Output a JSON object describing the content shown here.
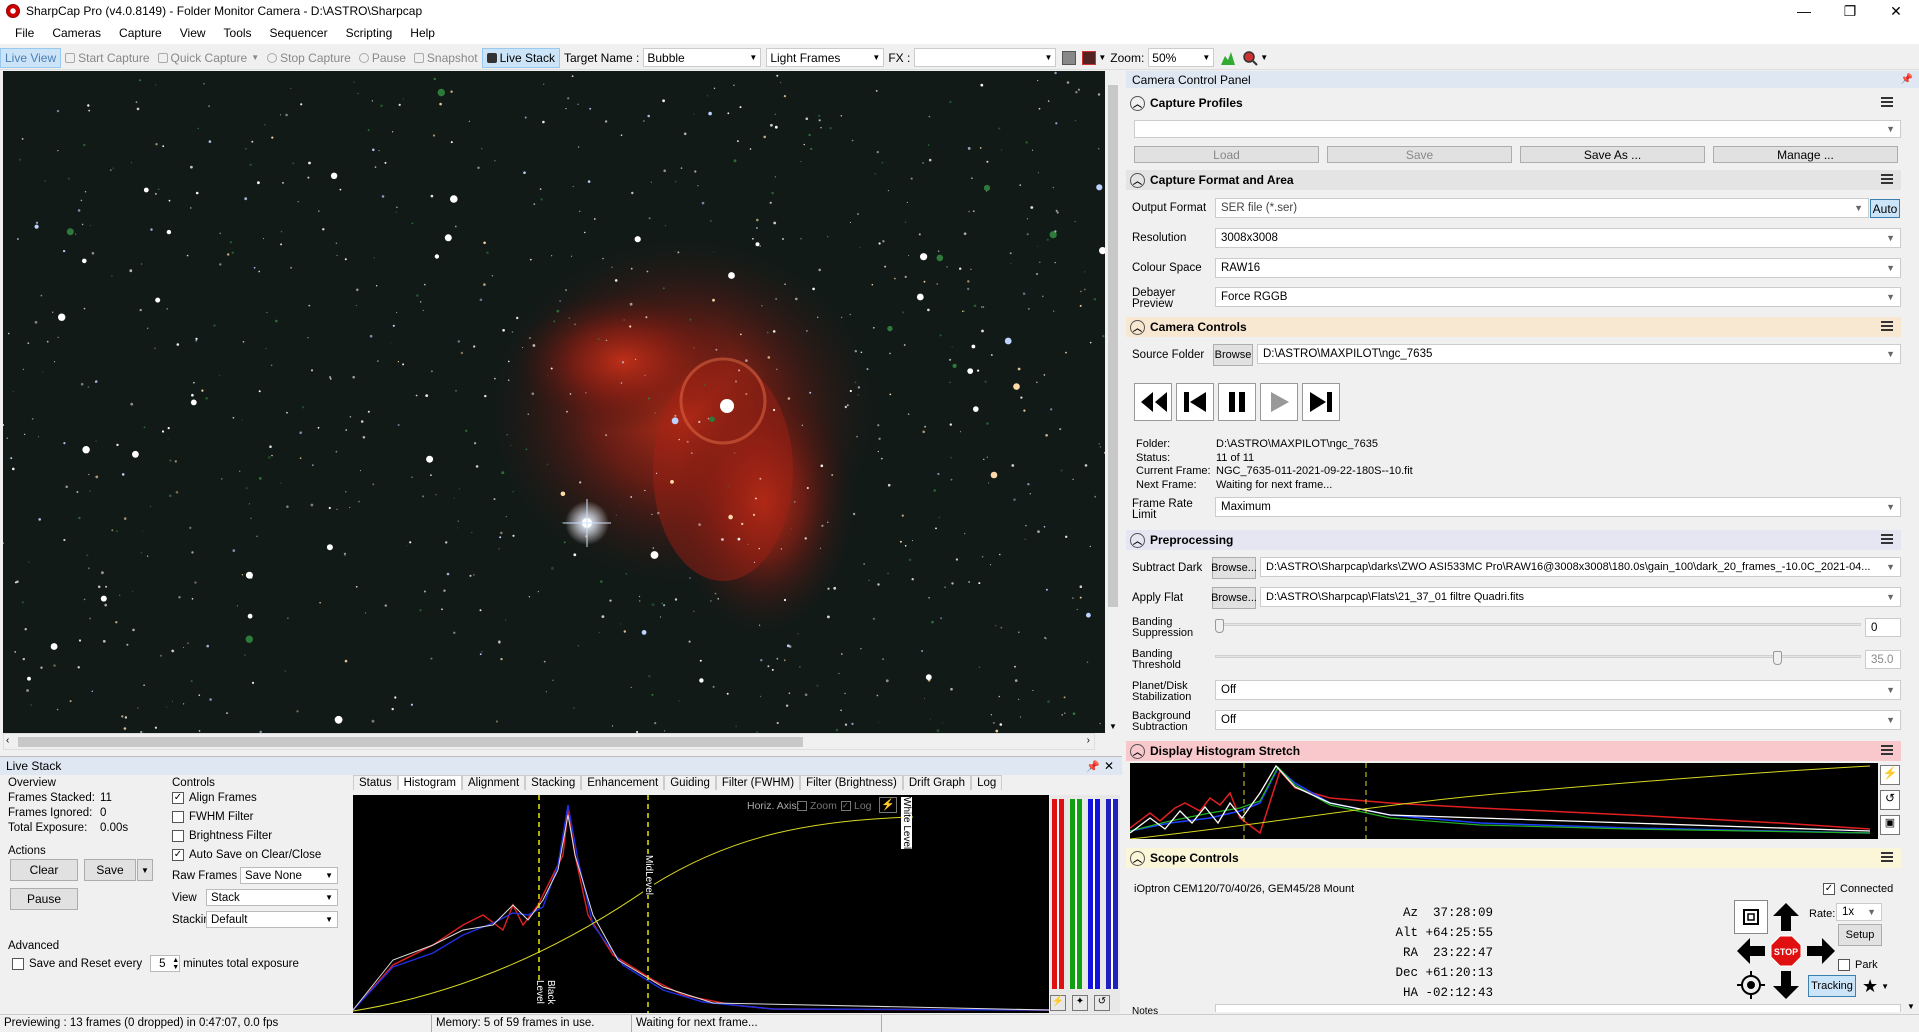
{
  "window": {
    "title": "SharpCap Pro (v4.0.8149) - Folder Monitor Camera - D:\\ASTRO\\Sharpcap",
    "min": "—",
    "max": "❐",
    "close": "✕"
  },
  "menu": [
    "File",
    "Cameras",
    "Capture",
    "View",
    "Tools",
    "Sequencer",
    "Scripting",
    "Help"
  ],
  "toolbar": {
    "live_view": "Live View",
    "start_capture": "Start Capture",
    "quick_capture": "Quick Capture",
    "stop_capture": "Stop Capture",
    "pause": "Pause",
    "snapshot": "Snapshot",
    "live_stack": "Live Stack",
    "target_label": "Target Name :",
    "target_value": "Bubble",
    "frame_type": "Light Frames",
    "fx_label": "FX :",
    "fx_value": "",
    "zoom_label": "Zoom:",
    "zoom_value": "50%"
  },
  "live_stack": {
    "title": "Live Stack",
    "overview_label": "Overview",
    "frames_stacked_label": "Frames Stacked:",
    "frames_stacked": "11",
    "frames_ignored_label": "Frames Ignored:",
    "frames_ignored": "0",
    "total_exposure_label": "Total Exposure:",
    "total_exposure": "0.00s",
    "actions_label": "Actions",
    "clear": "Clear",
    "save": "Save",
    "pause": "Pause",
    "advanced_label": "Advanced",
    "save_reset": "Save and Reset every",
    "save_reset_value": "5",
    "save_reset_suffix": "minutes total exposure",
    "controls_label": "Controls",
    "align_frames": "Align Frames",
    "fwhm_filter": "FWHM Filter",
    "brightness_filter": "Brightness Filter",
    "auto_save": "Auto Save on Clear/Close",
    "raw_frames_label": "Raw Frames",
    "raw_frames_value": "Save None",
    "view_label": "View",
    "view_value": "Stack",
    "stacking_label": "Stacking",
    "stacking_value": "Default",
    "tabs": [
      "Status",
      "Histogram",
      "Alignment",
      "Stacking",
      "Enhancement",
      "Guiding",
      "Filter (FWHM)",
      "Filter (Brightness)",
      "Drift Graph",
      "Log"
    ],
    "histo_axis_label": "Horiz. Axis:",
    "histo_zoom": "Zoom",
    "histo_log": "Log",
    "black_level": "Black Level",
    "mid_level": "MidLevel",
    "white_level": "White Level"
  },
  "ccp": {
    "title": "Camera Control Panel",
    "profiles": {
      "title": "Capture Profiles",
      "load": "Load",
      "save": "Save",
      "save_as": "Save As ...",
      "manage": "Manage ..."
    },
    "format": {
      "title": "Capture Format and Area",
      "output_label": "Output Format",
      "output_value": "SER file (*.ser)",
      "auto": "Auto",
      "resolution_label": "Resolution",
      "resolution_value": "3008x3008",
      "colour_label": "Colour Space",
      "colour_value": "RAW16",
      "debayer_label1": "Debayer",
      "debayer_label2": "Preview",
      "debayer_value": "Force RGGB"
    },
    "camera": {
      "title": "Camera Controls",
      "source_label": "Source Folder",
      "browse": "Browse",
      "source_value": "D:\\ASTRO\\MAXPILOT\\ngc_7635",
      "folder_label": "Folder:",
      "folder_value": "D:\\ASTRO\\MAXPILOT\\ngc_7635",
      "status_label": "Status:",
      "status_value": "11 of 11",
      "current_label": "Current Frame:",
      "current_value": "NGC_7635-011-2021-09-22-180S--10.fit",
      "next_label": "Next Frame:",
      "next_value": "Waiting for next frame...",
      "frl1": "Frame Rate",
      "frl2": "Limit",
      "frl_value": "Maximum"
    },
    "pre": {
      "title": "Preprocessing",
      "dark_label": "Subtract Dark",
      "browse": "Browse...",
      "dark_value": "D:\\ASTRO\\Sharpcap\\darks\\ZWO ASI533MC Pro\\RAW16@3008x3008\\180.0s\\gain_100\\dark_20_frames_-10.0C_2021-04...",
      "flat_label": "Apply Flat",
      "flat_value": "D:\\ASTRO\\Sharpcap\\Flats\\21_37_01 filtre Quadri.fits",
      "bs1": "Banding",
      "bs2": "Suppression",
      "bs_value": "0",
      "bt1": "Banding",
      "bt2": "Threshold",
      "bt_value": "35.0",
      "pd1": "Planet/Disk",
      "pd2": "Stabilization",
      "pd_value": "Off",
      "bg1": "Background",
      "bg2": "Subtraction",
      "bg_value": "Off"
    },
    "histo": {
      "title": "Display Histogram Stretch"
    },
    "scope": {
      "title": "Scope Controls",
      "mount": "iOptron CEM120/70/40/26, GEM45/28 Mount",
      "connected": "Connected",
      "az_label": "Az",
      "az": "37:28:09",
      "alt_label": "Alt",
      "alt": "+64:25:55",
      "ra_label": "RA",
      "ra": "23:22:47",
      "dec_label": "Dec",
      "dec": "+61:20:13",
      "ha_label": "HA",
      "ha": "-02:12:43",
      "rate_label": "Rate:",
      "rate_value": "1x",
      "setup": "Setup",
      "park": "Park",
      "tracking": "Tracking",
      "stop": "STOP",
      "notes_label": "Notes"
    }
  },
  "status": {
    "preview": "Previewing : 13 frames (0 dropped) in 0:47:07, 0.0 fps",
    "memory": "Memory: 5 of 59 frames in use.",
    "waiting": "Waiting for next frame..."
  }
}
